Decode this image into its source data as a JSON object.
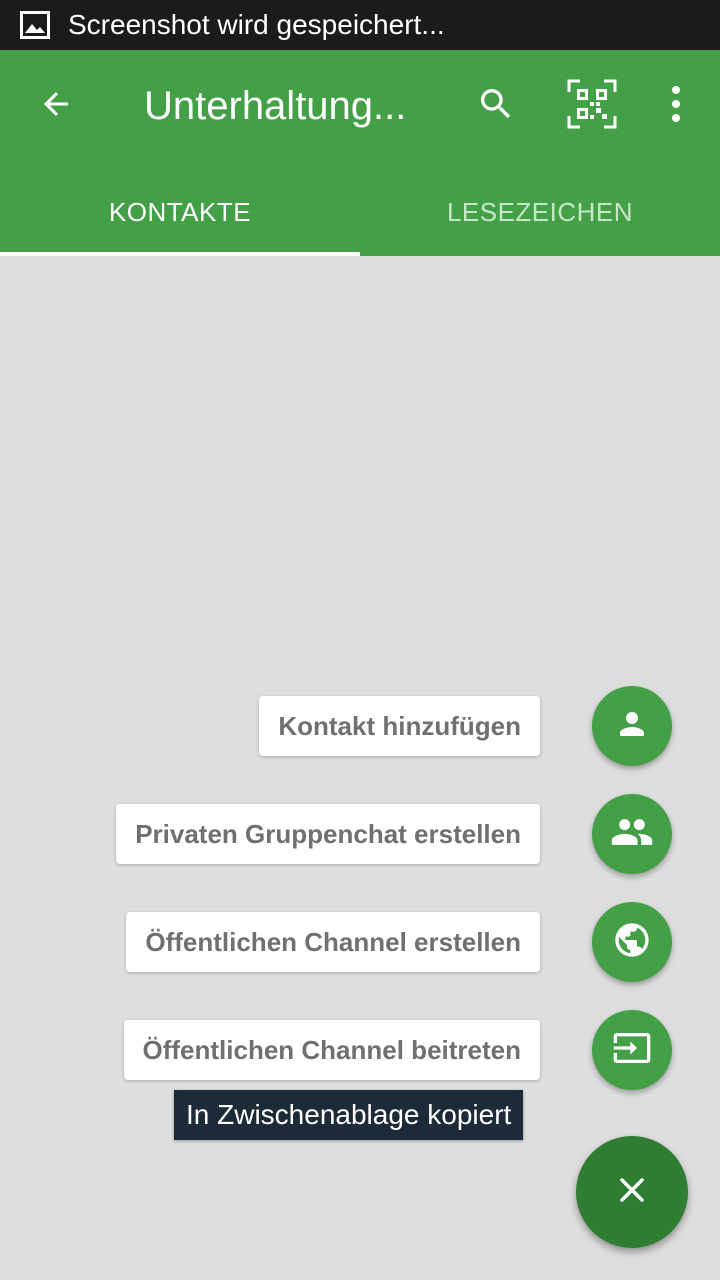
{
  "status_bar": {
    "notification_icon": "image-icon",
    "text": "Screenshot wird gespeichert..."
  },
  "app_bar": {
    "title": "Unterhaltung...",
    "back_icon": "arrow-back-icon",
    "search_icon": "search-icon",
    "qr_icon": "qr-code-scan-icon",
    "more_icon": "more-vert-icon",
    "color": "#43a047"
  },
  "tabs": [
    {
      "label": "KONTAKTE",
      "selected": true
    },
    {
      "label": "LESEZEICHEN",
      "selected": false
    }
  ],
  "fab_menu": {
    "items": [
      {
        "label": "Kontakt hinzufügen",
        "icon": "person-icon"
      },
      {
        "label": "Privaten Gruppenchat erstellen",
        "icon": "group-icon"
      },
      {
        "label": "Öffentlichen Channel erstellen",
        "icon": "globe-icon"
      },
      {
        "label": "Öffentlichen Channel beitreten",
        "icon": "input-icon"
      }
    ],
    "close_icon": "close-icon",
    "fab_color": "#2e7d32"
  },
  "toast": {
    "text": "In Zwischenablage kopiert"
  }
}
